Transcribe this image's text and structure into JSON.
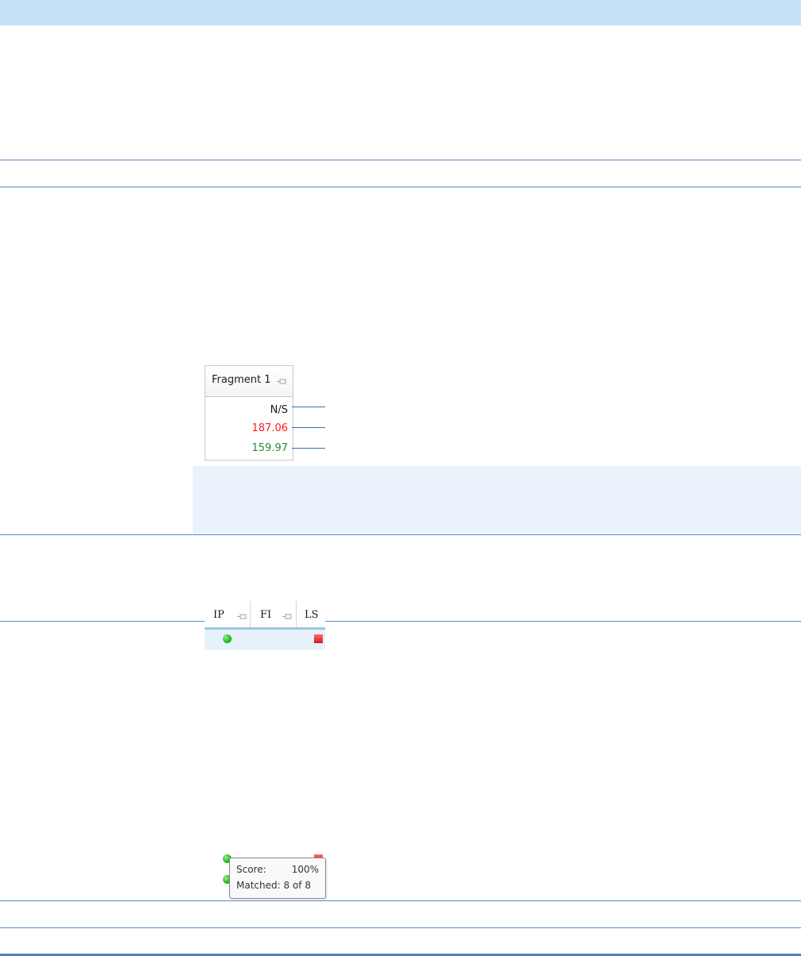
{
  "fragment_table": {
    "header": "Fragment 1",
    "values": [
      {
        "text": "N/S",
        "color": "#1a1a1a"
      },
      {
        "text": "187.06",
        "color": "#ff1a1a"
      },
      {
        "text": "159.97",
        "color": "#2a8a2a"
      }
    ]
  },
  "status_grid": {
    "columns": [
      "IP",
      "FI",
      "LS"
    ],
    "tooltip": {
      "score_label": "Score:",
      "score_value": "100%",
      "matched_label": "Matched:",
      "matched_value": "8 of 8"
    }
  },
  "icons": {
    "pin": "pin-icon",
    "status_ok": "green-dot-icon",
    "status_fail": "red-square-icon"
  },
  "colors": {
    "accent_band": "#c6e0f5",
    "rule": "#5b8cc3",
    "note_band": "#eaf3fc"
  }
}
